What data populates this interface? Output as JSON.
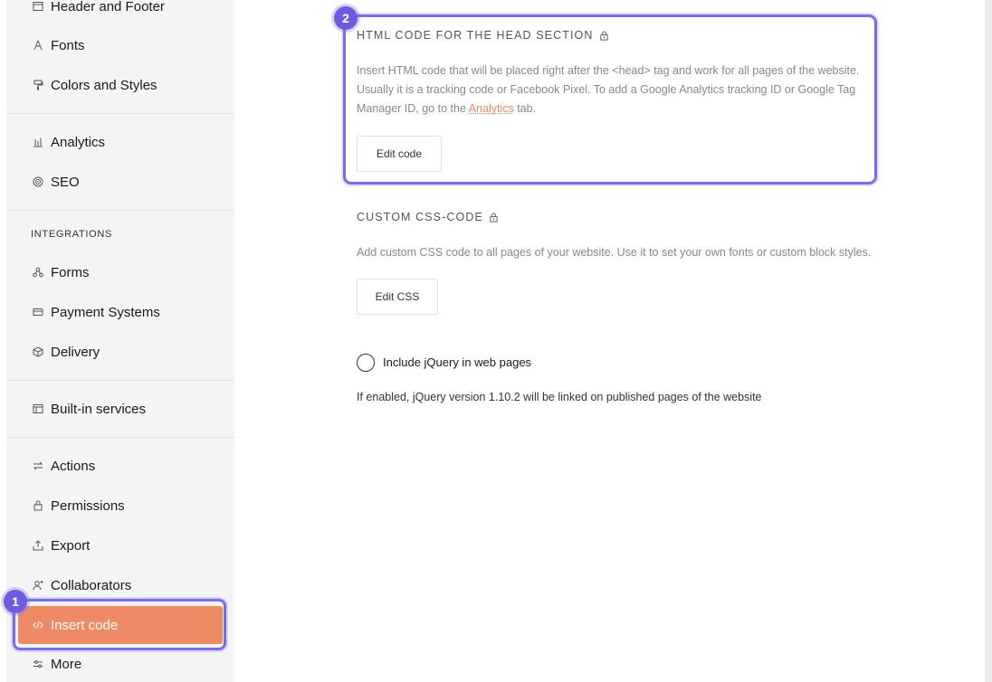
{
  "sidebar": {
    "items_top": [
      {
        "label": "Header and Footer",
        "icon": "layout-icon"
      },
      {
        "label": "Fonts",
        "icon": "font-icon"
      },
      {
        "label": "Colors and Styles",
        "icon": "paint-roller-icon"
      }
    ],
    "items_mid": [
      {
        "label": "Analytics",
        "icon": "bar-chart-icon"
      },
      {
        "label": "SEO",
        "icon": "target-icon"
      }
    ],
    "integrations_heading": "INTEGRATIONS",
    "items_integrations": [
      {
        "label": "Forms",
        "icon": "forms-icon"
      },
      {
        "label": "Payment Systems",
        "icon": "card-icon"
      },
      {
        "label": "Delivery",
        "icon": "box-icon"
      }
    ],
    "items_services": [
      {
        "label": "Built-in services",
        "icon": "services-icon"
      }
    ],
    "items_bottom": [
      {
        "label": "Actions",
        "icon": "arrows-icon"
      },
      {
        "label": "Permissions",
        "icon": "lock-icon"
      },
      {
        "label": "Export",
        "icon": "export-icon"
      },
      {
        "label": "Collaborators",
        "icon": "add-user-icon"
      },
      {
        "label": "Insert code",
        "icon": "code-icon",
        "active": true
      },
      {
        "label": "More",
        "icon": "sliders-icon"
      }
    ]
  },
  "badges": {
    "one": "1",
    "two": "2"
  },
  "head_section": {
    "title": "HTML CODE FOR THE HEAD SECTION",
    "desc_line1": "Insert HTML code that will be placed right after the <head> tag and work for all pages of the website.",
    "desc_line2": "Usually it is a tracking code or Facebook Pixel. To add a Google Analytics tracking ID or Google Tag",
    "desc_line3_pre": "Manager ID, go to the ",
    "desc_link": "Analytics",
    "desc_line3_post": " tab.",
    "button": "Edit code"
  },
  "css_section": {
    "title": "CUSTOM CSS-CODE",
    "desc": "Add custom CSS code to all pages of your website. Use it to set your own fonts or custom block styles.",
    "button": "Edit CSS"
  },
  "jquery": {
    "label": "Include jQuery in web pages",
    "checked": false,
    "note": "If enabled, jQuery version 1.10.2 will be linked on published pages of the website"
  },
  "colors": {
    "accent": "#ef8a66",
    "highlight": "#7c6ae8",
    "badge": "#6e5be0"
  }
}
